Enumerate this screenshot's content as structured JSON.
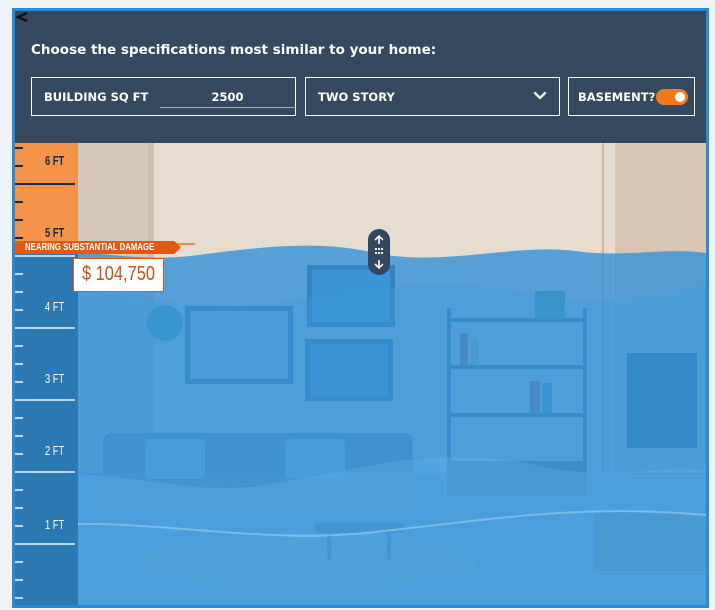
{
  "panel": {
    "title": "Choose the specifications most similar to your home:",
    "sqft_label": "BUILDING SQ FT",
    "sqft_value": "2500",
    "story_value": "TWO STORY",
    "basement_label": "BASEMENT?",
    "basement_on": true
  },
  "ruler": {
    "labels": [
      "6 FT",
      "5 FT",
      "4 FT",
      "3 FT",
      "2 FT",
      "1 FT"
    ]
  },
  "damage": {
    "tag": "NEARING SUBSTANTIAL DAMAGE",
    "cost": "$ 104,750"
  },
  "water_level_ft": 4.8,
  "colors": {
    "accent": "#f07a1c",
    "panel": "#34495f",
    "water": "#2e8fd8",
    "ruler": "#2b78b3"
  },
  "icons": {
    "chevron": "chevron-down-icon",
    "drag": "drag-handle-icon"
  }
}
